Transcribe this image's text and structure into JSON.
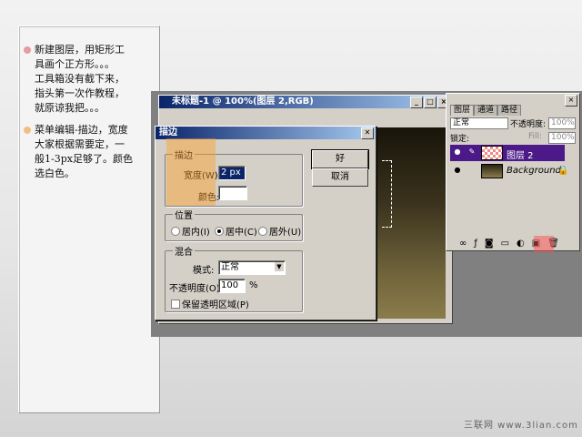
{
  "notes": {
    "bullets": [
      {
        "text": "新建图层，用矩形工\n具画个正方形。。。\n工具箱没有截下来，\n指头第一次作教程，\n就原谅我把。。。",
        "color": "#e89aa0"
      },
      {
        "text": "菜单编辑-描边，宽度\n大家根据需要定，一\n般1-3px足够了。颜色\n选白色。",
        "color": "#f0c080"
      }
    ]
  },
  "doc_window": {
    "title": "未标题-1 @ 100%(图层 2,RGB)"
  },
  "stroke_dialog": {
    "title": "描边",
    "stroke_group": "描边",
    "width_label": "宽度(W):",
    "width_value": "2 px",
    "color_label": "颜色:",
    "position_group": "位置",
    "inside": "居内(I)",
    "center": "居中(C)",
    "outside": "居外(U)",
    "blend_group": "混合",
    "mode_label": "模式:",
    "mode_value": "正常",
    "opacity_label": "不透明度(O):",
    "opacity_value": "100",
    "opacity_unit": "%",
    "preserve": "保留透明区域(P)",
    "ok": "好",
    "cancel": "取消",
    "close": "✕"
  },
  "layers_panel": {
    "tabs": [
      "图层",
      "通道",
      "路径"
    ],
    "blend": "正常",
    "opacity_label": "不透明度:",
    "opacity_value": "100%",
    "lock_label": "锁定:",
    "fill_label": "Fill:",
    "fill_value": "100%",
    "layers": [
      {
        "name": "图层 2",
        "selected": true
      },
      {
        "name": "Background",
        "selected": false
      }
    ]
  },
  "watermark": "三联网 www.3lian.com",
  "colors": {
    "selection": "#4b1a88",
    "highlight": "#ffa028"
  }
}
